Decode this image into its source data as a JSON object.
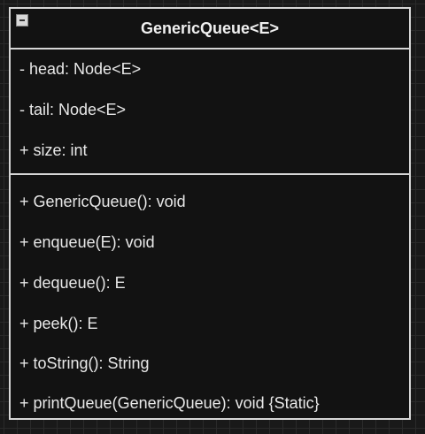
{
  "class_box": {
    "title": "GenericQueue<E>",
    "attributes": [
      "- head: Node<E>",
      "- tail: Node<E>",
      "+ size: int"
    ],
    "methods": [
      "+ GenericQueue(): void",
      "+ enqueue(E): void",
      "+ dequeue(): E",
      "+ peek(): E",
      "+ toString(): String",
      "+ printQueue(GenericQueue): void {Static}"
    ]
  },
  "colors": {
    "background": "#191919",
    "grid": "#2a2a2a",
    "border": "#d6d6d6",
    "text": "#e6e6e6"
  },
  "icons": {
    "collapse": "collapse-minus-icon"
  }
}
